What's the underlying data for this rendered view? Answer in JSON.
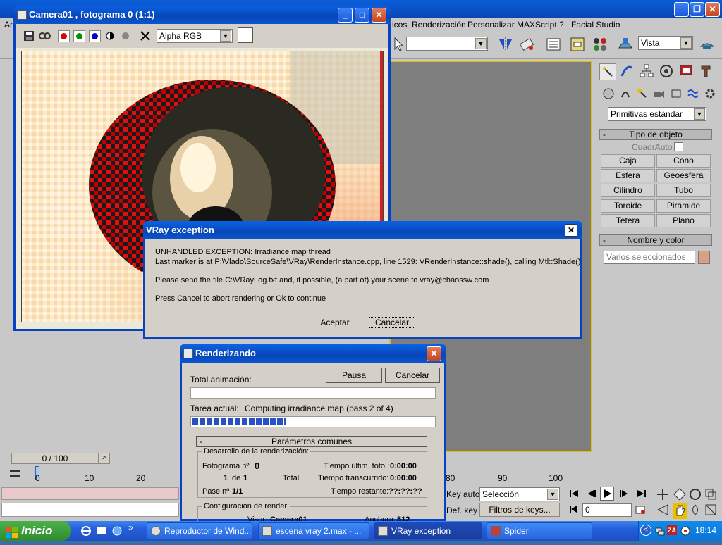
{
  "max": {
    "menus": [
      "Ar",
      "icos",
      "Renderización",
      "Personalizar",
      "MAXScript",
      "?",
      "Facial Studio"
    ],
    "toolbar": {
      "view_select": "Vista"
    },
    "command_panel": {
      "category_select": "Primitivas estándar",
      "rollout_object_type": "Tipo de objeto",
      "autogrid": "CuadrAuto",
      "buttons": [
        "Caja",
        "Cono",
        "Esfera",
        "Geoesfera",
        "Cilindro",
        "Tubo",
        "Toroide",
        "Pirámide",
        "Tetera",
        "Plano"
      ],
      "rollout_name_color": "Nombre y color",
      "name_field": "Varios seleccionados",
      "object_color": "#d9a088",
      "rollout_minus": "-"
    },
    "timeline": {
      "slider_text": "0 / 100",
      "ticks": [
        "0",
        "10",
        "20",
        "80",
        "90",
        "100"
      ]
    },
    "anim": {
      "key_auto": "Key auto",
      "selection_select": "Selección",
      "def_key": "Def. key",
      "key_filters": "Filtros de keys...",
      "frame_field": "0"
    }
  },
  "render_frame": {
    "title": "Camera01 , fotograma 0 (1:1)",
    "channel_select": "Alpha RGB",
    "channel_colors": [
      "#e00000",
      "#009000",
      "#0000d0"
    ]
  },
  "vray_dialog": {
    "title": "VRay exception",
    "line1": "UNHANDLED EXCEPTION: Irradiance map thread",
    "line2": "Last marker is at P:\\Vlado\\SourceSafe\\VRay\\RenderInstance.cpp, line 1529: VRenderInstance::shade(), calling Mtl::Shade()",
    "line3": "Please send the file C:\\VRayLog.txt and, if possible, (a part of) your scene to vray@chaossw.com",
    "line4": "Press Cancel to abort rendering or Ok to continue",
    "ok_label": "Aceptar",
    "cancel_label": "Cancelar"
  },
  "render_progress": {
    "title": "Renderizando",
    "pause_label": "Pausa",
    "cancel_label": "Cancelar",
    "total_anim_label": "Total animación:",
    "current_task_label": "Tarea actual:",
    "current_task_value": "Computing irradiance map (pass 2 of 4)",
    "current_task_progress": 0.39,
    "total_anim_progress": 0,
    "common_params_header": "Parámetros comunes",
    "common_params_minus": "-",
    "render_progress_group": "Desarrollo de la renderización:",
    "frame_label": "Fotograma nº",
    "frame_value": "0",
    "frame_count_current": "1",
    "frame_count_of": "de",
    "frame_count_total": "1",
    "total_label": "Total",
    "pass_label": "Pase nº",
    "pass_value": "1/1",
    "last_frame_time_label": "Tiempo últim. foto.:",
    "last_frame_time_value": "0:00:00",
    "elapsed_label": "Tiempo transcurrido:",
    "elapsed_value": "0:00:00",
    "remaining_label": "Tiempo restante:",
    "remaining_value": "??:??:??",
    "config_group": "Configuración de render:",
    "viewport_label": "Visor:",
    "viewport_value": "Camera01",
    "width_label": "Anchura:",
    "width_value": "512"
  },
  "taskbar": {
    "start_label": "Inicio",
    "tasks": [
      "Reproductor de Wind...",
      "escena vray 2.max - ...",
      "VRay exception",
      "Spider"
    ],
    "clock": "18:14"
  }
}
